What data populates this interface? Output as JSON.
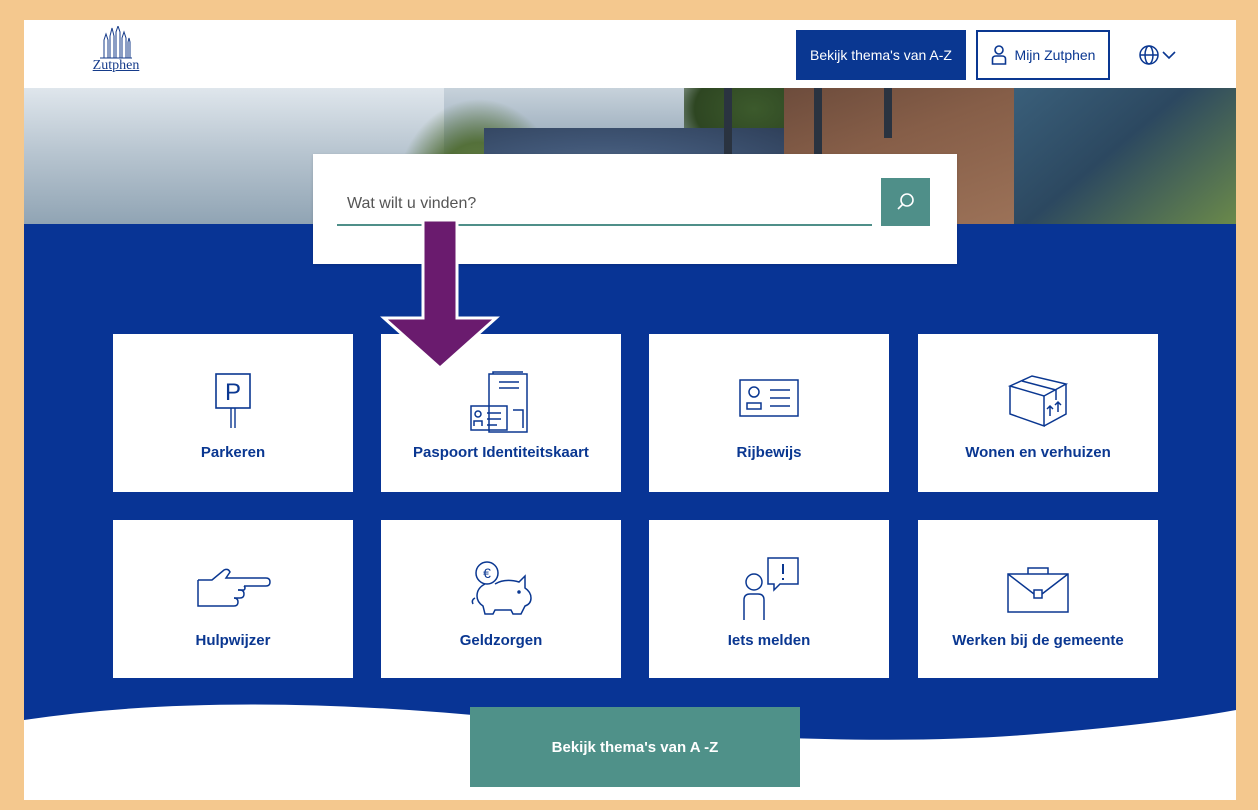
{
  "header": {
    "logo_text": "Zutphen",
    "az_button_label": "Bekijk thema's van A-Z",
    "mijn_button_label": "Mijn Zutphen"
  },
  "search": {
    "placeholder": "Wat wilt u vinden?"
  },
  "tiles": [
    {
      "label": "Parkeren",
      "icon": "parking-sign-icon"
    },
    {
      "label": "Paspoort Identiteitskaart",
      "icon": "passport-id-icon"
    },
    {
      "label": "Rijbewijs",
      "icon": "drivers-license-icon"
    },
    {
      "label": "Wonen en verhuizen",
      "icon": "moving-box-icon"
    },
    {
      "label": "Hulpwijzer",
      "icon": "pointing-hand-icon"
    },
    {
      "label": "Geldzorgen",
      "icon": "piggy-bank-icon"
    },
    {
      "label": "Iets melden",
      "icon": "report-person-icon"
    },
    {
      "label": "Werken bij de gemeente",
      "icon": "briefcase-icon"
    }
  ],
  "cta": {
    "label": "Bekijk thema's van A -Z"
  },
  "colors": {
    "brand_blue": "#0a3791",
    "teal": "#4f9189",
    "annotation_purple": "#6a1b6e",
    "frame_orange": "#f4c88e"
  }
}
